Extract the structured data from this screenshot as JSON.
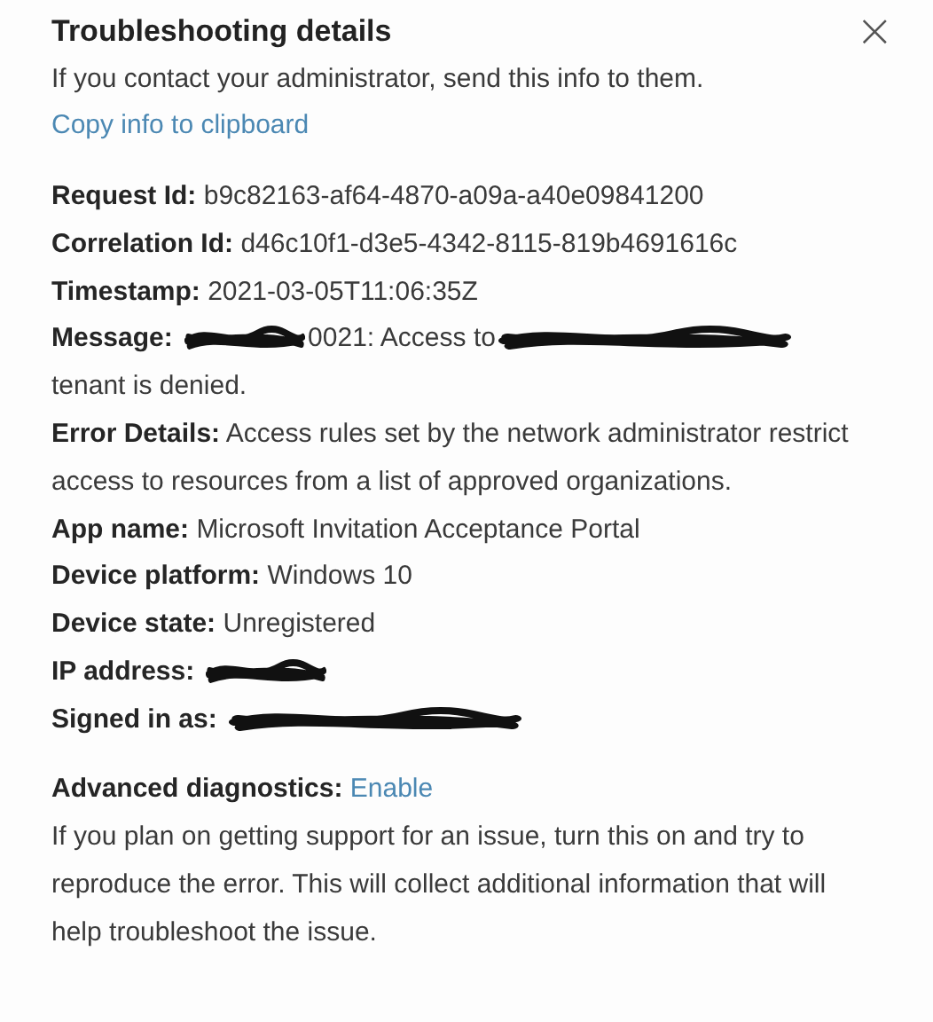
{
  "title": "Troubleshooting details",
  "close": "×",
  "subtitle": "If you contact your administrator, send this info to them.",
  "copy_link": "Copy info to clipboard",
  "details": [
    {
      "label": "Request Id:",
      "segments": [
        {
          "kind": "text",
          "text": "b9c82163-af64-4870-a09a-a40e09841200"
        }
      ]
    },
    {
      "label": "Correlation Id:",
      "segments": [
        {
          "kind": "text",
          "text": "d46c10f1-d3e5-4342-8115-819b4691616c"
        }
      ]
    },
    {
      "label": "Timestamp:",
      "segments": [
        {
          "kind": "text",
          "text": "2021-03-05T11:06:35Z"
        }
      ]
    },
    {
      "label": "Message:",
      "segments": [
        {
          "kind": "short-redaction"
        },
        {
          "kind": "text",
          "text": "0021: Access to"
        },
        {
          "kind": "long-redaction"
        },
        {
          "kind": "text",
          "text": "tenant is denied."
        }
      ]
    },
    {
      "label": "Error Details:",
      "segments": [
        {
          "kind": "text",
          "text": "Access rules set by the network administrator restrict access to resources from a list of approved organizations."
        }
      ]
    },
    {
      "label": "App name:",
      "segments": [
        {
          "kind": "text",
          "text": "Microsoft Invitation Acceptance Portal"
        }
      ]
    },
    {
      "label": "Device platform:",
      "segments": [
        {
          "kind": "text",
          "text": "Windows 10"
        }
      ]
    },
    {
      "label": "Device state:",
      "segments": [
        {
          "kind": "text",
          "text": "Unregistered"
        }
      ]
    },
    {
      "label": "IP address:",
      "segments": [
        {
          "kind": "short-redaction"
        }
      ]
    },
    {
      "label": "Signed in as:",
      "segments": [
        {
          "kind": "long-redaction"
        }
      ]
    }
  ],
  "advanced": {
    "label": "Advanced diagnostics:",
    "link": "Enable",
    "description": "If you plan on getting support for an issue, turn this on and try to reproduce the error. This will collect additional information that will help troubleshoot the issue."
  }
}
